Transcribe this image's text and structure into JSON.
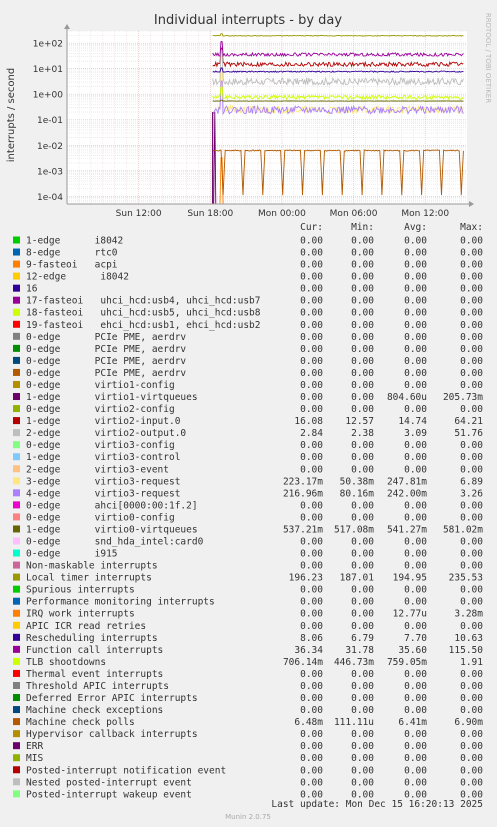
{
  "chart_data": {
    "type": "line",
    "title": "Individual interrupts - by day",
    "ylabel": "interrupts / second",
    "side_label": "RRDTOOL / TOBI OETIKER",
    "y_scale": "log",
    "ylim": [
      5e-05,
      300
    ],
    "y_ticks": [
      {
        "value": 100,
        "label": "1e+02"
      },
      {
        "value": 10,
        "label": "1e+01"
      },
      {
        "value": 1,
        "label": "1e+00"
      },
      {
        "value": 0.1,
        "label": "1e-01"
      },
      {
        "value": 0.01,
        "label": "1e-02"
      },
      {
        "value": 0.001,
        "label": "1e-03"
      },
      {
        "value": 0.0001,
        "label": "1e-04"
      }
    ],
    "x_range_hours": [
      0,
      33.5
    ],
    "x_ticks": [
      {
        "value": 6,
        "label": "Sun 12:00"
      },
      {
        "value": 12,
        "label": "Sun 18:00"
      },
      {
        "value": 18,
        "label": "Mon 00:00"
      },
      {
        "value": 24,
        "label": "Mon 06:00"
      },
      {
        "value": 30,
        "label": "Mon 12:00"
      }
    ],
    "data_start_hour": 12.2,
    "grid": true,
    "legend_headers": [
      "Cur:",
      "Min:",
      "Avg:",
      "Max:"
    ],
    "series": [
      {
        "name": "1-edge      i8042",
        "color": "#00cc00",
        "cur": "0.00",
        "min": "0.00",
        "avg": "0.00",
        "max": "0.00"
      },
      {
        "name": "8-edge      rtc0",
        "color": "#0066b3",
        "cur": "0.00",
        "min": "0.00",
        "avg": "0.00",
        "max": "0.00"
      },
      {
        "name": "9-fasteoi   acpi",
        "color": "#ff8000",
        "cur": "0.00",
        "min": "0.00",
        "avg": "0.00",
        "max": "0.00"
      },
      {
        "name": "12-edge      i8042",
        "color": "#ffcc00",
        "cur": "0.00",
        "min": "0.00",
        "avg": "0.00",
        "max": "0.00"
      },
      {
        "name": "16",
        "color": "#330099",
        "cur": "0.00",
        "min": "0.00",
        "avg": "0.00",
        "max": "0.00"
      },
      {
        "name": "17-fasteoi   uhci_hcd:usb4, uhci_hcd:usb7",
        "color": "#990099",
        "cur": "0.00",
        "min": "0.00",
        "avg": "0.00",
        "max": "0.00"
      },
      {
        "name": "18-fasteoi   uhci_hcd:usb5, uhci_hcd:usb8",
        "color": "#ccff00",
        "cur": "0.00",
        "min": "0.00",
        "avg": "0.00",
        "max": "0.00"
      },
      {
        "name": "19-fasteoi   ehci_hcd:usb1, ehci_hcd:usb2",
        "color": "#ff0000",
        "cur": "0.00",
        "min": "0.00",
        "avg": "0.00",
        "max": "0.00"
      },
      {
        "name": "0-edge      PCIe PME, aerdrv",
        "color": "#808080",
        "cur": "0.00",
        "min": "0.00",
        "avg": "0.00",
        "max": "0.00"
      },
      {
        "name": "0-edge      PCIe PME, aerdrv",
        "color": "#008f00",
        "cur": "0.00",
        "min": "0.00",
        "avg": "0.00",
        "max": "0.00"
      },
      {
        "name": "0-edge      PCIe PME, aerdrv",
        "color": "#00487d",
        "cur": "0.00",
        "min": "0.00",
        "avg": "0.00",
        "max": "0.00"
      },
      {
        "name": "0-edge      PCIe PME, aerdrv",
        "color": "#b35a00",
        "cur": "0.00",
        "min": "0.00",
        "avg": "0.00",
        "max": "0.00"
      },
      {
        "name": "0-edge      virtio1-config",
        "color": "#b38f00",
        "cur": "0.00",
        "min": "0.00",
        "avg": "0.00",
        "max": "0.00"
      },
      {
        "name": "1-edge      virtio1-virtqueues",
        "color": "#6b006b",
        "cur": "0.00",
        "min": "0.00",
        "avg": "804.60u",
        "max": "205.73m"
      },
      {
        "name": "0-edge      virtio2-config",
        "color": "#8fb300",
        "cur": "0.00",
        "min": "0.00",
        "avg": "0.00",
        "max": "0.00"
      },
      {
        "name": "1-edge      virtio2-input.0",
        "color": "#b30000",
        "cur": "16.08",
        "min": "12.57",
        "avg": "14.74",
        "max": "64.21"
      },
      {
        "name": "2-edge      virtio2-output.0",
        "color": "#bebebe",
        "cur": "2.84",
        "min": "2.38",
        "avg": "3.09",
        "max": "51.76"
      },
      {
        "name": "0-edge      virtio3-config",
        "color": "#80ff80",
        "cur": "0.00",
        "min": "0.00",
        "avg": "0.00",
        "max": "0.00"
      },
      {
        "name": "1-edge      virtio3-control",
        "color": "#80c9ff",
        "cur": "0.00",
        "min": "0.00",
        "avg": "0.00",
        "max": "0.00"
      },
      {
        "name": "2-edge      virtio3-event",
        "color": "#ffc080",
        "cur": "0.00",
        "min": "0.00",
        "avg": "0.00",
        "max": "0.00"
      },
      {
        "name": "3-edge      virtio3-request",
        "color": "#ffe680",
        "cur": "223.17m",
        "min": "50.38m",
        "avg": "247.81m",
        "max": "6.89"
      },
      {
        "name": "4-edge      virtio3-request",
        "color": "#aa80ff",
        "cur": "216.96m",
        "min": "80.16m",
        "avg": "242.00m",
        "max": "3.26"
      },
      {
        "name": "0-edge      ahci[0000:00:1f.2]",
        "color": "#ee00cc",
        "cur": "0.00",
        "min": "0.00",
        "avg": "0.00",
        "max": "0.00"
      },
      {
        "name": "0-edge      virtio0-config",
        "color": "#ff8080",
        "cur": "0.00",
        "min": "0.00",
        "avg": "0.00",
        "max": "0.00"
      },
      {
        "name": "1-edge      virtio0-virtqueues",
        "color": "#666600",
        "cur": "537.21m",
        "min": "517.08m",
        "avg": "541.27m",
        "max": "581.02m"
      },
      {
        "name": "0-edge      snd_hda_intel:card0",
        "color": "#ffbfff",
        "cur": "0.00",
        "min": "0.00",
        "avg": "0.00",
        "max": "0.00"
      },
      {
        "name": "0-edge      i915",
        "color": "#00ffcc",
        "cur": "0.00",
        "min": "0.00",
        "avg": "0.00",
        "max": "0.00"
      },
      {
        "name": "Non-maskable interrupts",
        "color": "#cc6699",
        "cur": "0.00",
        "min": "0.00",
        "avg": "0.00",
        "max": "0.00"
      },
      {
        "name": "Local timer interrupts",
        "color": "#999900",
        "cur": "196.23",
        "min": "187.01",
        "avg": "194.95",
        "max": "235.53"
      },
      {
        "name": "Spurious interrupts",
        "color": "#00cc00",
        "cur": "0.00",
        "min": "0.00",
        "avg": "0.00",
        "max": "0.00"
      },
      {
        "name": "Performance monitoring interrupts",
        "color": "#0066b3",
        "cur": "0.00",
        "min": "0.00",
        "avg": "0.00",
        "max": "0.00"
      },
      {
        "name": "IRQ work interrupts",
        "color": "#ff8000",
        "cur": "0.00",
        "min": "0.00",
        "avg": "12.77u",
        "max": "3.28m"
      },
      {
        "name": "APIC ICR read retries",
        "color": "#ffcc00",
        "cur": "0.00",
        "min": "0.00",
        "avg": "0.00",
        "max": "0.00"
      },
      {
        "name": "Rescheduling interrupts",
        "color": "#330099",
        "cur": "8.06",
        "min": "6.79",
        "avg": "7.70",
        "max": "10.63"
      },
      {
        "name": "Function call interrupts",
        "color": "#990099",
        "cur": "36.34",
        "min": "31.78",
        "avg": "35.60",
        "max": "115.50"
      },
      {
        "name": "TLB shootdowns",
        "color": "#ccff00",
        "cur": "706.14m",
        "min": "446.73m",
        "avg": "759.05m",
        "max": "1.91"
      },
      {
        "name": "Thermal event interrupts",
        "color": "#ff0000",
        "cur": "0.00",
        "min": "0.00",
        "avg": "0.00",
        "max": "0.00"
      },
      {
        "name": "Threshold APIC interrupts",
        "color": "#808080",
        "cur": "0.00",
        "min": "0.00",
        "avg": "0.00",
        "max": "0.00"
      },
      {
        "name": "Deferred Error APIC interrupts",
        "color": "#008f00",
        "cur": "0.00",
        "min": "0.00",
        "avg": "0.00",
        "max": "0.00"
      },
      {
        "name": "Machine check exceptions",
        "color": "#00487d",
        "cur": "0.00",
        "min": "0.00",
        "avg": "0.00",
        "max": "0.00"
      },
      {
        "name": "Machine check polls",
        "color": "#b35a00",
        "cur": "6.48m",
        "min": "111.11u",
        "avg": "6.41m",
        "max": "6.90m"
      },
      {
        "name": "Hypervisor callback interrupts",
        "color": "#b38f00",
        "cur": "0.00",
        "min": "0.00",
        "avg": "0.00",
        "max": "0.00"
      },
      {
        "name": "ERR",
        "color": "#6b006b",
        "cur": "0.00",
        "min": "0.00",
        "avg": "0.00",
        "max": "0.00"
      },
      {
        "name": "MIS",
        "color": "#8fb300",
        "cur": "0.00",
        "min": "0.00",
        "avg": "0.00",
        "max": "0.00"
      },
      {
        "name": "Posted-interrupt notification event",
        "color": "#b30000",
        "cur": "0.00",
        "min": "0.00",
        "avg": "0.00",
        "max": "0.00"
      },
      {
        "name": "Nested posted-interrupt event",
        "color": "#bebebe",
        "cur": "0.00",
        "min": "0.00",
        "avg": "0.00",
        "max": "0.00"
      },
      {
        "name": "Posted-interrupt wakeup event",
        "color": "#80ff80",
        "cur": "0.00",
        "min": "0.00",
        "avg": "0.00",
        "max": "0.00"
      }
    ],
    "last_update": "Last update: Mon Dec 15 16:20:13 2025",
    "footer": "Munin 2.0.75"
  }
}
